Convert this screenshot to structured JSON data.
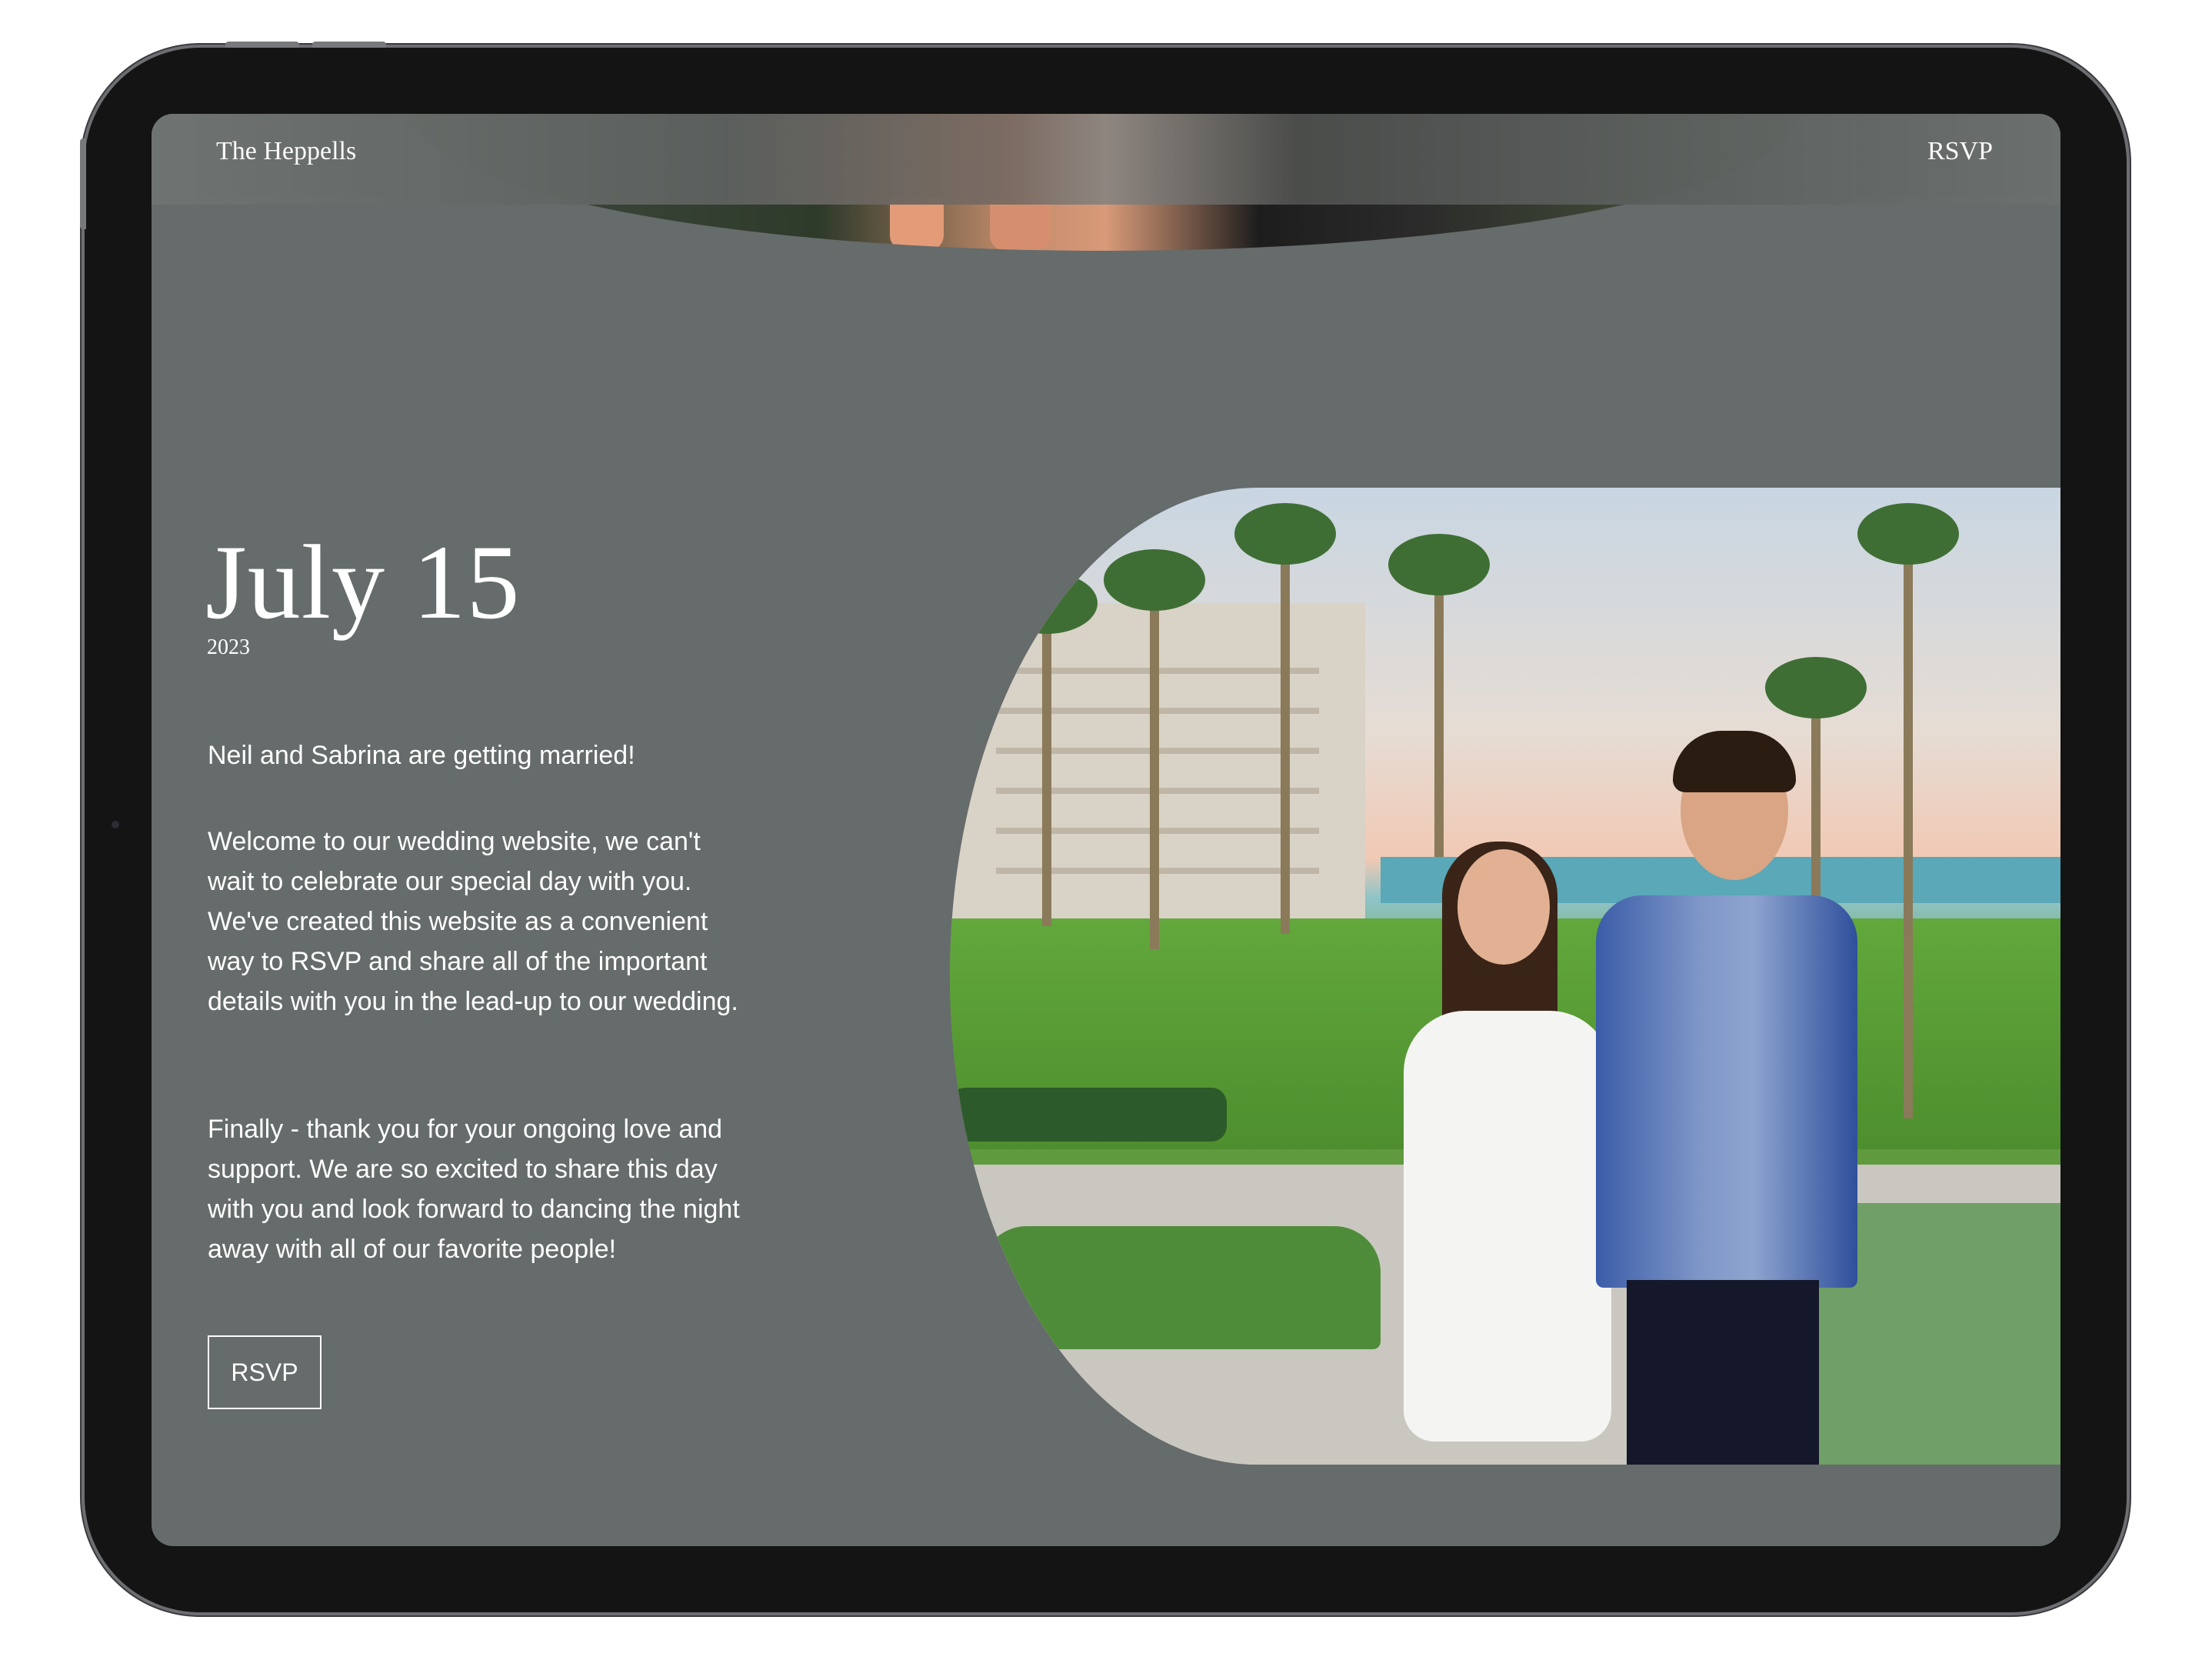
{
  "nav": {
    "brand": "The Heppells",
    "rsvp_label": "RSVP"
  },
  "hero": {
    "date": "July 15",
    "year": "2023"
  },
  "content": {
    "paragraphs": [
      "Neil and Sabrina are getting married!",
      "Welcome to our wedding website, we can't wait to celebrate our special day with you. We've created this website as a convenient way to RSVP and share all of the important details with you in the lead-up to our wedding.",
      "Finally - thank you for your ongoing love and support. We are so excited to share this day with you and look forward to dancing the night away with all of our favorite people!"
    ],
    "rsvp_button": "RSVP"
  },
  "colors": {
    "page_background": "#666b6b",
    "text": "#ffffff",
    "device_frame": "#141414"
  }
}
